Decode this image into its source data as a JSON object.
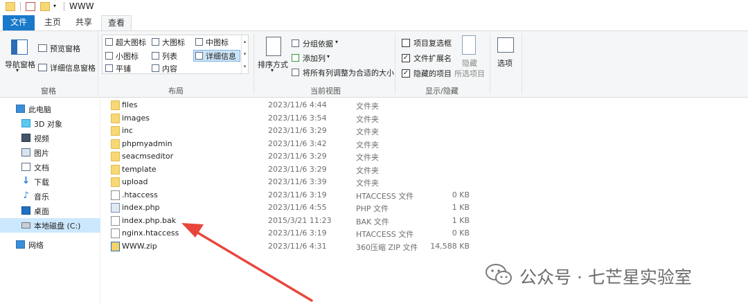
{
  "window": {
    "title": "WWW"
  },
  "tabs": [
    {
      "label": "文件"
    },
    {
      "label": "主页"
    },
    {
      "label": "共享"
    },
    {
      "label": "查看"
    }
  ],
  "ribbon": {
    "panes": {
      "nav_pane": "导航窗格",
      "preview_pane": "预览窗格",
      "details_pane": "详细信息窗格",
      "group_label": "窗格"
    },
    "layout": {
      "items": [
        "超大图标",
        "大图标",
        "中图标",
        "小图标",
        "列表",
        "详细信息",
        "平铺",
        "内容"
      ],
      "selected": "详细信息",
      "group_label": "布局"
    },
    "current_view": {
      "sort": "排序方式",
      "group_by": "分组依据",
      "add_column": "添加列",
      "fit_columns": "将所有列调整为合适的大小",
      "group_label": "当前视图"
    },
    "show_hide": {
      "item_checkboxes": {
        "label": "项目复选框",
        "checked": false
      },
      "file_extensions": {
        "label": "文件扩展名",
        "checked": true
      },
      "hidden_items": {
        "label": "隐藏的项目",
        "checked": true
      },
      "hide_selected_1": "隐藏",
      "hide_selected_2": "所选项目",
      "group_label": "显示/隐藏"
    },
    "options": {
      "label": "选项"
    }
  },
  "nav": {
    "items": [
      {
        "label": "此电脑",
        "icon": "computer-icon"
      },
      {
        "label": "3D 对象",
        "icon": "cube-icon"
      },
      {
        "label": "视频",
        "icon": "video-icon"
      },
      {
        "label": "图片",
        "icon": "picture-icon"
      },
      {
        "label": "文档",
        "icon": "document-icon"
      },
      {
        "label": "下载",
        "icon": "download-icon"
      },
      {
        "label": "音乐",
        "icon": "music-icon"
      },
      {
        "label": "桌面",
        "icon": "desktop-icon"
      },
      {
        "label": "本地磁盘 (C:)",
        "icon": "drive-icon",
        "selected": true
      },
      {
        "label": "网络",
        "icon": "network-icon"
      }
    ]
  },
  "files": [
    {
      "name": "files",
      "date": "2023/11/6 4:44",
      "type": "文件夹",
      "size": "",
      "icon": "folder-icon"
    },
    {
      "name": "images",
      "date": "2023/11/6 3:54",
      "type": "文件夹",
      "size": "",
      "icon": "folder-icon"
    },
    {
      "name": "inc",
      "date": "2023/11/6 3:29",
      "type": "文件夹",
      "size": "",
      "icon": "folder-icon"
    },
    {
      "name": "phpmyadmin",
      "date": "2023/11/6 3:42",
      "type": "文件夹",
      "size": "",
      "icon": "folder-icon"
    },
    {
      "name": "seacmseditor",
      "date": "2023/11/6 3:29",
      "type": "文件夹",
      "size": "",
      "icon": "folder-icon"
    },
    {
      "name": "template",
      "date": "2023/11/6 3:29",
      "type": "文件夹",
      "size": "",
      "icon": "folder-icon"
    },
    {
      "name": "upload",
      "date": "2023/11/6 3:39",
      "type": "文件夹",
      "size": "",
      "icon": "folder-icon"
    },
    {
      "name": ".htaccess",
      "date": "2023/11/6 3:19",
      "type": "HTACCESS 文件",
      "size": "0 KB",
      "icon": "file-icon"
    },
    {
      "name": "index.php",
      "date": "2023/11/6 4:55",
      "type": "PHP 文件",
      "size": "1 KB",
      "icon": "php-file-icon"
    },
    {
      "name": "index.php.bak",
      "date": "2015/3/21 11:23",
      "type": "BAK 文件",
      "size": "1 KB",
      "icon": "file-icon"
    },
    {
      "name": "nginx.htaccess",
      "date": "2023/11/6 3:19",
      "type": "HTACCESS 文件",
      "size": "0 KB",
      "icon": "file-icon"
    },
    {
      "name": "WWW.zip",
      "date": "2023/11/6 4:31",
      "type": "360压缩 ZIP 文件",
      "size": "14,588 KB",
      "icon": "zip-icon"
    }
  ],
  "annotation": {
    "color": "#e8463c"
  },
  "watermark": {
    "text": "公众号 · 七芒星实验室"
  },
  "colors": {
    "file_tab": "#1979ca",
    "folder": "#f8d775",
    "selection": "#cce8ff"
  }
}
